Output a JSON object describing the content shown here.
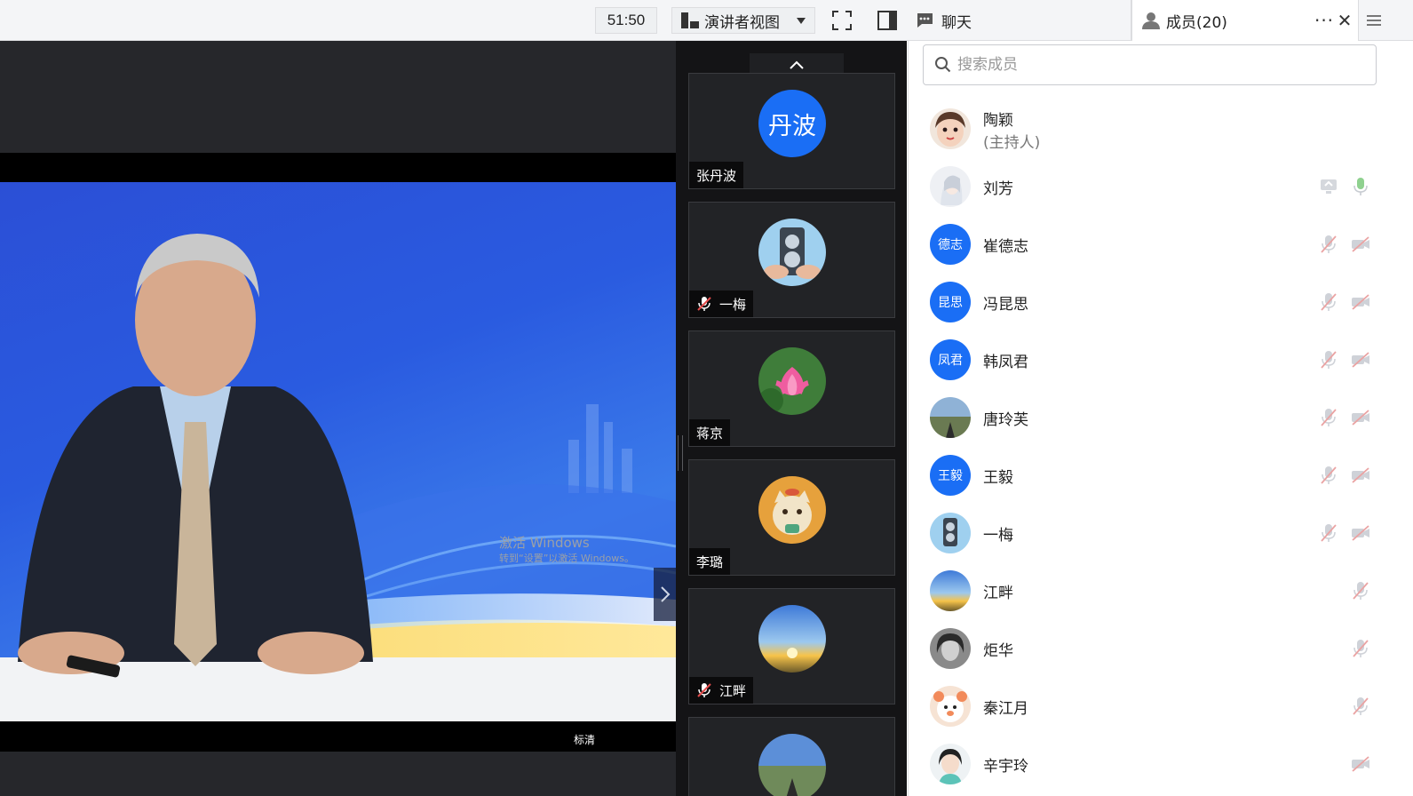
{
  "topbar": {
    "timer": "51:50",
    "view_mode": "演讲者视图",
    "chat_tab": "聊天",
    "members_tab": "成员(20)",
    "more": "···",
    "close": "✕"
  },
  "stage": {
    "quality": "标清",
    "watermark_line1": "激活 Windows",
    "watermark_line2": "转到“设置”以激活 Windows。"
  },
  "gallery": {
    "tiles": [
      {
        "name": "张丹波",
        "avatar_text": "丹波",
        "muted": false
      },
      {
        "name": "一梅",
        "avatar_text": "",
        "muted": true
      },
      {
        "name": "蒋京",
        "avatar_text": "",
        "muted": false
      },
      {
        "name": "李璐",
        "avatar_text": "",
        "muted": false
      },
      {
        "name": "江畔",
        "avatar_text": "",
        "muted": true
      },
      {
        "name": "",
        "avatar_text": "",
        "muted": false
      }
    ]
  },
  "members": {
    "search_placeholder": "搜索成员",
    "list": [
      {
        "name": "陶颖",
        "role": "(主持人)",
        "avatar_text": ""
      },
      {
        "name": "刘芳",
        "role": "",
        "avatar_text": ""
      },
      {
        "name": "崔德志",
        "role": "",
        "avatar_text": "德志"
      },
      {
        "name": "冯昆思",
        "role": "",
        "avatar_text": "昆思"
      },
      {
        "name": "韩凤君",
        "role": "",
        "avatar_text": "凤君"
      },
      {
        "name": "唐玲芙",
        "role": "",
        "avatar_text": ""
      },
      {
        "name": "王毅",
        "role": "",
        "avatar_text": "王毅"
      },
      {
        "name": "一梅",
        "role": "",
        "avatar_text": ""
      },
      {
        "name": "江畔",
        "role": "",
        "avatar_text": ""
      },
      {
        "name": "炬华",
        "role": "",
        "avatar_text": ""
      },
      {
        "name": "秦江月",
        "role": "",
        "avatar_text": ""
      },
      {
        "name": "辛宇玲",
        "role": "",
        "avatar_text": ""
      }
    ]
  },
  "colors": {
    "accent_blue": "#1a6ef5",
    "muted_icon": "#e8a0a0",
    "mic_on": "#8fd18f"
  }
}
